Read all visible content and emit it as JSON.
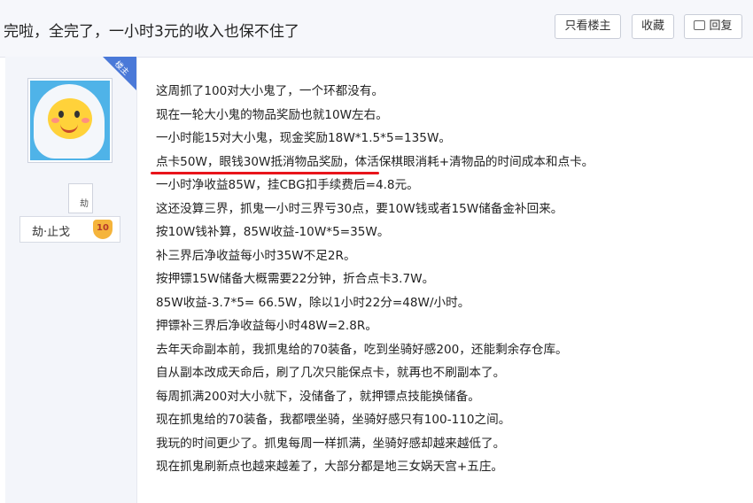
{
  "header": {
    "title": "完啦，全完了，一小时3元的收入也保不住了",
    "buttons": {
      "author_only": "只看楼主",
      "favorite": "收藏",
      "reply": "回复"
    }
  },
  "sidebar": {
    "badge": "楼主",
    "mini_text": "劫",
    "username": "劫·止戈",
    "level": "10"
  },
  "post": {
    "lines": [
      "这周抓了100对大小鬼了，一个环都没有。",
      "现在一轮大小鬼的物品奖励也就10W左右。",
      "一小时能15对大小鬼，现金奖励18W*1.5*5=135W。",
      "点卡50W，眼钱30W抵消物品奖励，体活保棋眼消耗+清物品的时间成本和点卡。",
      "一小时净收益85W，挂CBG扣手续费后=4.8元。",
      "这还没算三界，抓鬼一小时三界亏30点，要10W钱或者15W储备金补回来。",
      "按10W钱补算，85W收益-10W*5=35W。",
      "补三界后净收益每小时35W不足2R。",
      "按押镖15W储备大概需要22分钟，折合点卡3.7W。",
      "85W收益-3.7*5= 66.5W，除以1小时22分=48W/小时。",
      "押镖补三界后净收益每小时48W=2.8R。",
      "去年天命副本前，我抓鬼给的70装备，吃到坐骑好感200，还能剩余存仓库。",
      "自从副本改成天命后，刷了几次只能保点卡，就再也不刷副本了。",
      "每周抓满200对大小就下，没储备了，就押镖点技能换储备。",
      "现在抓鬼给的70装备，我都喂坐骑，坐骑好感只有100-110之间。",
      "我玩的时间更少了。抓鬼每周一样抓满，坐骑好感却越来越低了。",
      "现在抓鬼刷新点也越来越差了，大部分都是地三女娲天宫+五庄。"
    ],
    "highlight_color": "#e8141b"
  }
}
